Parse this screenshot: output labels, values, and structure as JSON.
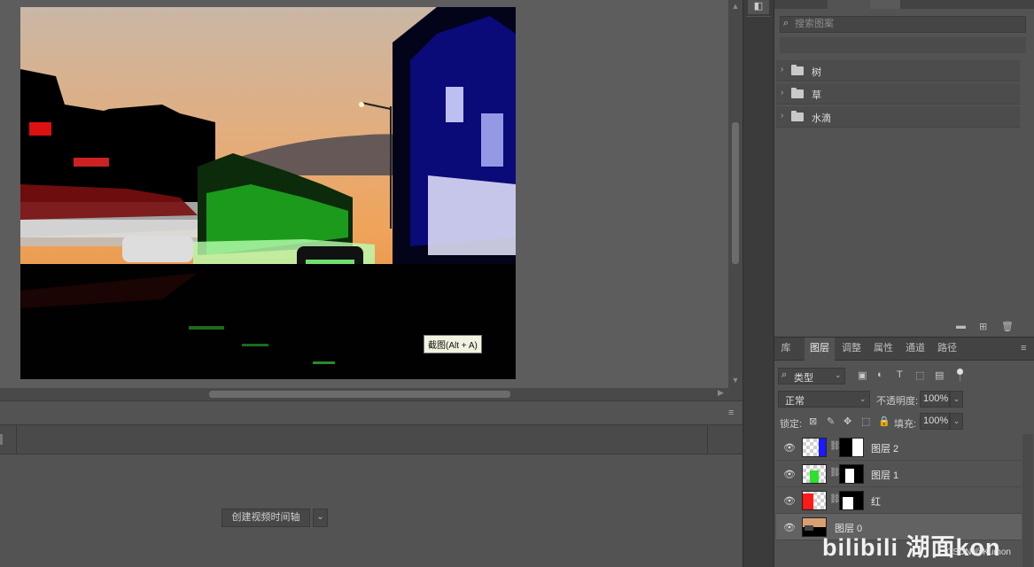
{
  "canvas": {
    "tooltip": "截图(Alt + A)"
  },
  "timeline": {
    "create_button_label": "创建视频时间轴",
    "menu_icon": "hamburger-icon",
    "dropdown_icon": "chevron-down-icon"
  },
  "patterns_panel": {
    "search_placeholder": "搜索图案",
    "groups": [
      {
        "label": "树"
      },
      {
        "label": "草"
      },
      {
        "label": "水滴"
      }
    ]
  },
  "layers_panel": {
    "tabs": [
      {
        "label": "库",
        "active": false
      },
      {
        "label": "图层",
        "active": true
      },
      {
        "label": "调整",
        "active": false
      },
      {
        "label": "属性",
        "active": false
      },
      {
        "label": "通道",
        "active": false
      },
      {
        "label": "路径",
        "active": false
      }
    ],
    "filter_label": "类型",
    "blend_mode": "正常",
    "opacity_label": "不透明度:",
    "opacity_value": "100%",
    "lock_label": "锁定:",
    "fill_label": "填充:",
    "fill_value": "100%",
    "layers": [
      {
        "name": "图层 2",
        "color": "#1a1aff",
        "has_mask": true,
        "selected": false
      },
      {
        "name": "图层 1",
        "color": "#2ee02e",
        "has_mask": true,
        "selected": false
      },
      {
        "name": "红",
        "color": "#ff1a1a",
        "has_mask": true,
        "selected": false
      },
      {
        "name": "图层 0",
        "color": "",
        "has_mask": false,
        "selected": true
      }
    ]
  },
  "watermark": {
    "logo_text": "bilibili 湖面kon",
    "small_text": "CSDN @Kumon"
  }
}
